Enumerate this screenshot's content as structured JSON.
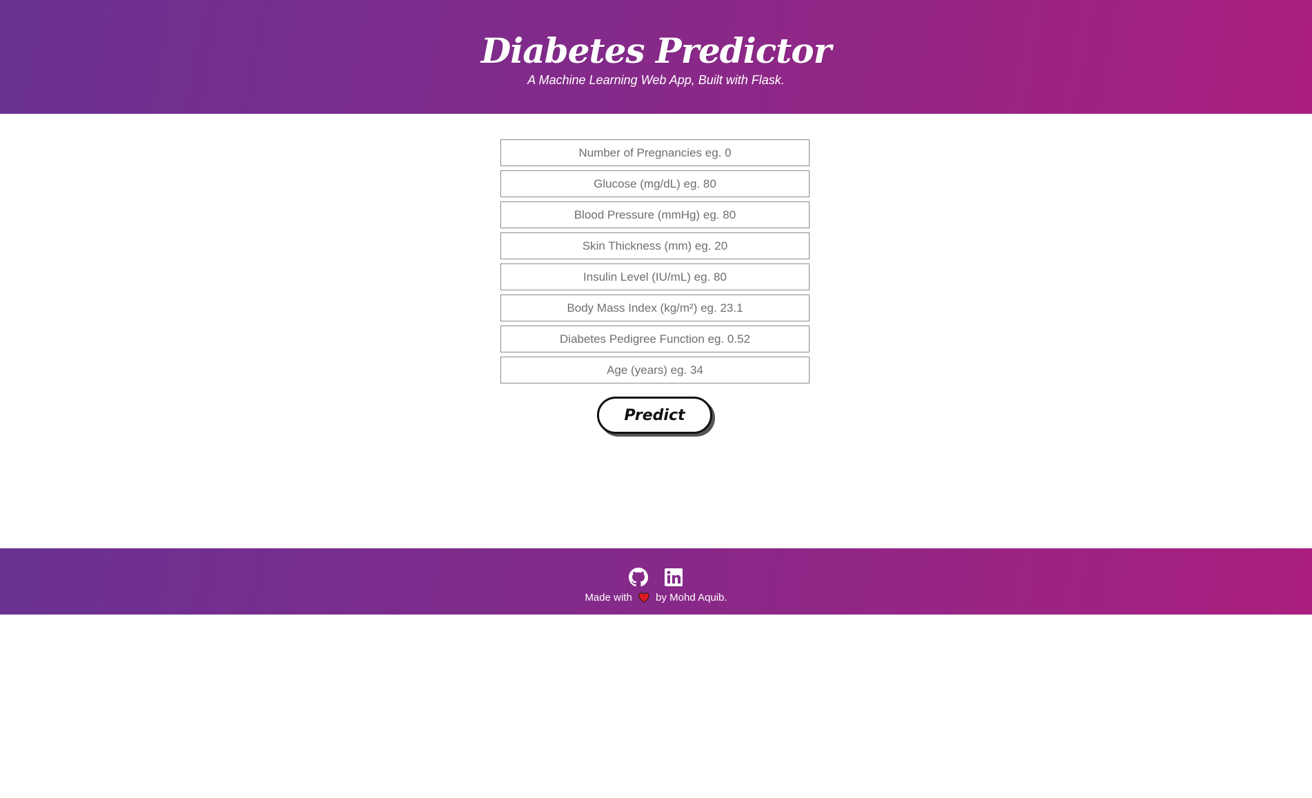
{
  "header": {
    "title": "Diabetes Predictor",
    "subtitle": "A Machine Learning Web App, Built with Flask."
  },
  "form": {
    "fields": [
      {
        "placeholder": "Number of Pregnancies eg. 0"
      },
      {
        "placeholder": "Glucose (mg/dL) eg. 80"
      },
      {
        "placeholder": "Blood Pressure (mmHg) eg. 80"
      },
      {
        "placeholder": "Skin Thickness (mm) eg. 20"
      },
      {
        "placeholder": "Insulin Level (IU/mL) eg. 80"
      },
      {
        "placeholder": "Body Mass Index (kg/m²) eg. 23.1"
      },
      {
        "placeholder": "Diabetes Pedigree Function eg. 0.52"
      },
      {
        "placeholder": "Age (years) eg. 34"
      }
    ],
    "submit_label": "Predict"
  },
  "footer": {
    "icons": [
      "github-icon",
      "linkedin-icon"
    ],
    "made_with": "Made with",
    "heart_icon": "heart-icon",
    "by_author": "by Mohd Aquib."
  },
  "colors": {
    "gradient_start": "#6a3293",
    "gradient_end": "#ab1f7f",
    "heart": "#e01b24"
  }
}
